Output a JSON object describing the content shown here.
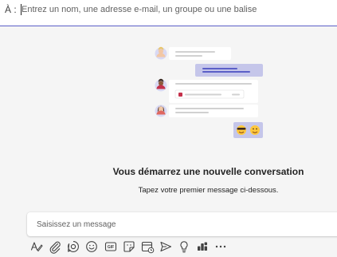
{
  "to_field": {
    "label": "À :",
    "placeholder": "Entrez un nom, une adresse e-mail, un groupe ou une balise"
  },
  "empty_state": {
    "title": "Vous démarrez une nouvelle conversation",
    "subtitle": "Tapez votre premier message ci-dessous."
  },
  "compose": {
    "placeholder": "Saisissez un message"
  },
  "toolbar": {
    "icons": [
      "format-icon",
      "attach-icon",
      "loop-icon",
      "emoji-icon",
      "gif-icon",
      "sticker-icon",
      "schedule-meeting-icon",
      "send-icon",
      "praise-icon",
      "apps-icon",
      "more-options-icon"
    ]
  },
  "colors": {
    "accent": "#5b5fc7",
    "background": "#f5f5f5",
    "bubble_sent": "#c5c6ea"
  }
}
